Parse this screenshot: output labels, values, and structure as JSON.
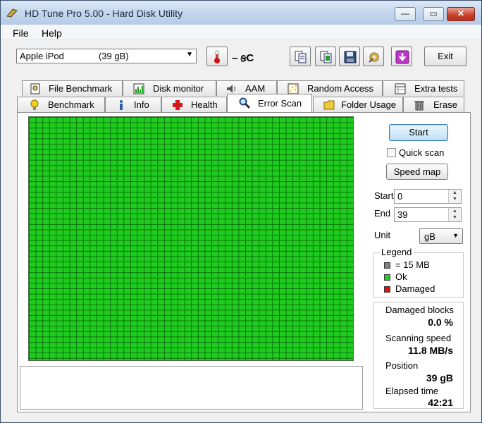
{
  "window": {
    "title": "HD Tune Pro 5.00 - Hard Disk Utility",
    "minimize": "—",
    "maximize": "▭",
    "close": "✕"
  },
  "menu": [
    {
      "label": "File"
    },
    {
      "label": "Help"
    }
  ],
  "toolbar": {
    "drive_name": "Apple   iPod",
    "drive_size": "(39 gB)",
    "temperature": "– ꞩC",
    "exit_label": "Exit"
  },
  "tabs_top": [
    {
      "label": "File Benchmark",
      "icon": "file-benchmark-icon"
    },
    {
      "label": "Disk monitor",
      "icon": "disk-monitor-icon"
    },
    {
      "label": "AAM",
      "icon": "speaker-icon"
    },
    {
      "label": "Random Access",
      "icon": "random-access-icon"
    },
    {
      "label": "Extra tests",
      "icon": "extra-tests-icon"
    }
  ],
  "tabs_bottom": [
    {
      "label": "Benchmark",
      "icon": "bulb-icon"
    },
    {
      "label": "Info",
      "icon": "info-icon"
    },
    {
      "label": "Health",
      "icon": "health-cross-icon"
    },
    {
      "label": "Error Scan",
      "icon": "magnifier-icon",
      "active": true
    },
    {
      "label": "Folder Usage",
      "icon": "folder-icon"
    },
    {
      "label": "Erase",
      "icon": "trash-icon"
    }
  ],
  "scan": {
    "start_button": "Start",
    "quick_scan_label": "Quick scan",
    "quick_scan_checked": false,
    "speed_map_button": "Speed map",
    "start_label": "Start",
    "start_value": "0",
    "end_label": "End",
    "end_value": "39",
    "unit_label": "Unit",
    "unit_value": "gB"
  },
  "legend": {
    "title": "Legend",
    "items": [
      {
        "label": "= 15 MB",
        "color": "#808080"
      },
      {
        "label": "Ok",
        "color": "#22cc22"
      },
      {
        "label": "Damaged",
        "color": "#e01010"
      }
    ]
  },
  "stats": {
    "damaged_blocks_label": "Damaged blocks",
    "damaged_blocks_value": "0.0 %",
    "scanning_speed_label": "Scanning speed",
    "scanning_speed_value": "11.8 MB/s",
    "position_label": "Position",
    "position_value": "39 gB",
    "elapsed_label": "Elapsed time",
    "elapsed_value": "42:21"
  },
  "colors": {
    "block_ok": "#1ecb1e",
    "grid_line": "#0a5a0a",
    "block_damaged": "#e01010"
  }
}
